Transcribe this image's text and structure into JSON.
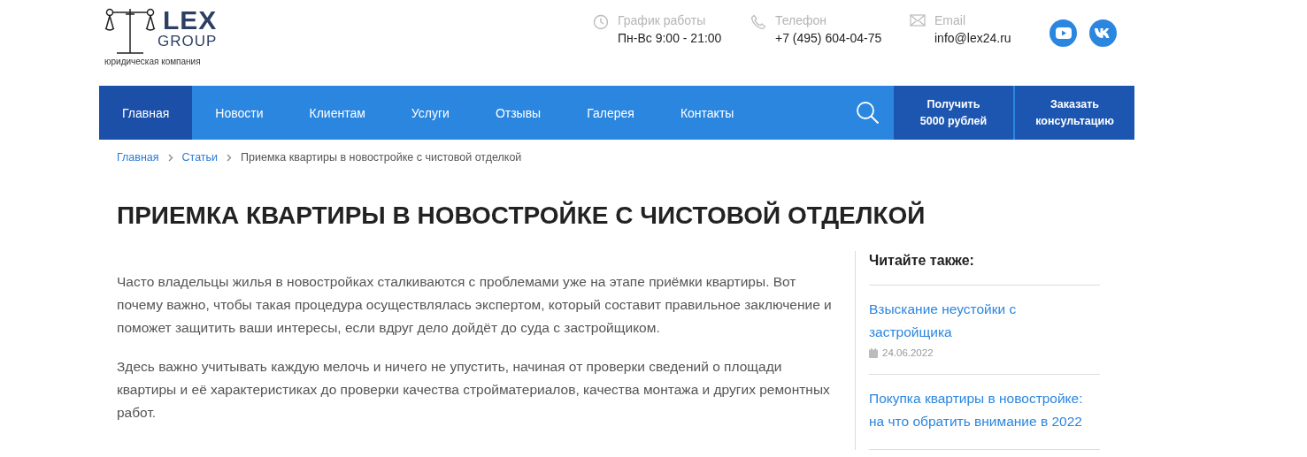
{
  "logo": {
    "word": "LEX",
    "group": "GROUP",
    "tagline": "юридическая компания"
  },
  "contacts": [
    {
      "kind": "clock",
      "label": "График работы",
      "value": "Пн-Вс 9:00 - 21:00"
    },
    {
      "kind": "phone",
      "label": "Телефон",
      "value": "+7 (495) 604-04-75"
    },
    {
      "kind": "mail",
      "label": "Email",
      "value": "info@lex24.ru"
    }
  ],
  "social": [
    {
      "kind": "youtube"
    },
    {
      "kind": "vk"
    }
  ],
  "nav": {
    "items": [
      {
        "label": "Главная",
        "selected": true
      },
      {
        "label": "Новости",
        "selected": false
      },
      {
        "label": "Клиентам",
        "selected": false
      },
      {
        "label": "Услуги",
        "selected": false
      },
      {
        "label": "Отзывы",
        "selected": false
      },
      {
        "label": "Галерея",
        "selected": false
      },
      {
        "label": "Контакты",
        "selected": false
      }
    ],
    "buttons": [
      {
        "line1": "Получить",
        "line2": "5000 рублей"
      },
      {
        "line1": "Заказать",
        "line2": "консультацию"
      }
    ]
  },
  "breadcrumbs": [
    {
      "label": "Главная",
      "link": true
    },
    {
      "label": "Статьи",
      "link": true
    },
    {
      "label": "Приемка квартиры в новостройке с чистовой отделкой",
      "link": false
    }
  ],
  "title": "ПРИЕМКА КВАРТИРЫ В НОВОСТРОЙКЕ С ЧИСТОВОЙ ОТДЕЛКОЙ",
  "paragraphs": [
    "Часто владельцы жилья в новостройках сталкиваются с проблемами уже на этапе приёмки квартиры. Вот почему важно, чтобы такая процедура осуществлялась экспертом, который составит правильное заключение и поможет защитить ваши интересы, если вдруг дело дойдёт до суда с застройщиком.",
    "Здесь важно учитывать каждую мелочь и ничего не упустить, начиная от проверки сведений о площади квартиры и её характеристиках до проверки качества стройматериалов, качества монтажа и других ремонтных работ."
  ],
  "sidebar": {
    "heading": "Читайте также:",
    "articles": [
      {
        "title": "Взыскание неустойки с застройщика",
        "date": "24.06.2022"
      },
      {
        "title": "Покупка квартиры в новостройке: на что обратить внимание в 2022"
      }
    ]
  }
}
